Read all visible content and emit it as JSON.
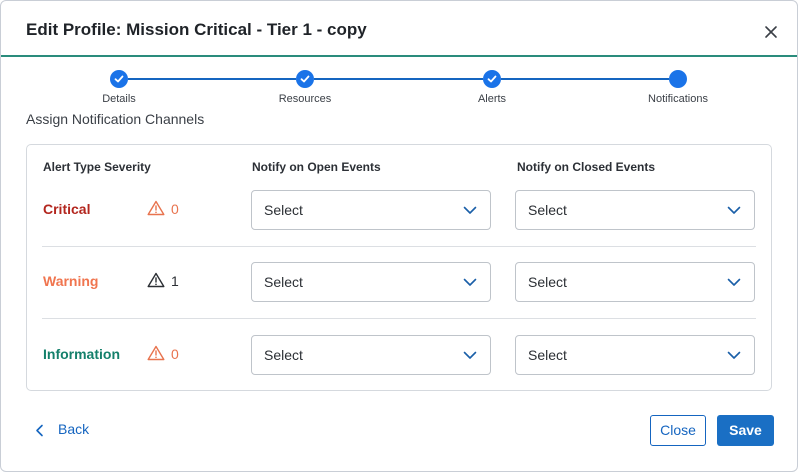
{
  "dialog": {
    "title": "Edit Profile: Mission Critical - Tier 1 - copy"
  },
  "stepper": {
    "steps": [
      {
        "label": "Details",
        "state": "complete"
      },
      {
        "label": "Resources",
        "state": "complete"
      },
      {
        "label": "Alerts",
        "state": "complete"
      },
      {
        "label": "Notifications",
        "state": "current"
      }
    ]
  },
  "section": {
    "title": "Assign Notification Channels"
  },
  "table": {
    "headers": {
      "severity": "Alert Type Severity",
      "open": "Notify on Open Events",
      "closed": "Notify on Closed Events"
    },
    "rows": [
      {
        "severity": "Critical",
        "color": "#b3261e",
        "count": "0",
        "count_color": "#e8734e",
        "icon_color": "#e8734e",
        "open": "Select",
        "closed": "Select"
      },
      {
        "severity": "Warning",
        "color": "#f0754f",
        "count": "1",
        "count_color": "#2b2f34",
        "icon_color": "#2b2f34",
        "open": "Select",
        "closed": "Select"
      },
      {
        "severity": "Information",
        "color": "#14806b",
        "count": "0",
        "count_color": "#e8734e",
        "icon_color": "#e8734e",
        "open": "Select",
        "closed": "Select"
      }
    ]
  },
  "footer": {
    "back_label": "Back",
    "close_label": "Close",
    "save_label": "Save"
  },
  "colors": {
    "accent": "#1a6fc4",
    "header_rule": "#2a8c7c"
  }
}
